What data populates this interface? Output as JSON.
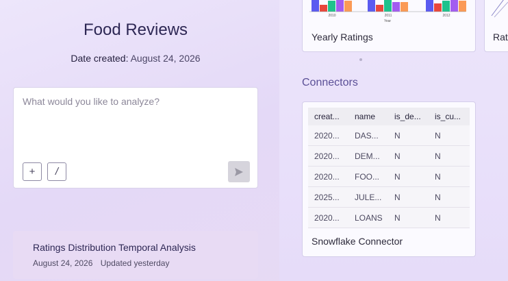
{
  "header": {
    "title": "Food Reviews",
    "date_label": "Date created:",
    "date_value": "August 24, 2026"
  },
  "composer": {
    "placeholder": "What would you like to analyze?",
    "add_label": "+",
    "slash_label": "/"
  },
  "analysis_item": {
    "title": "Ratings Distribution Temporal Analysis",
    "date": "August 24, 2026",
    "updated": "Updated yesterday"
  },
  "cards": {
    "yearly": {
      "title": "Yearly Ratings",
      "chart_data": {
        "type": "bar",
        "categories": [
          "2010",
          "2011",
          "2012"
        ],
        "xlabel": "Year",
        "series_colors": [
          "#5b5bf0",
          "#e8473c",
          "#1fc28c",
          "#a25cf0",
          "#fb9a56"
        ]
      }
    },
    "next_partial_title": "Rat"
  },
  "connectors": {
    "section_title": "Connectors",
    "table": {
      "columns": [
        "creat...",
        "name",
        "is_de...",
        "is_cu..."
      ],
      "rows": [
        [
          "2020...",
          "DAS...",
          "N",
          "N"
        ],
        [
          "2020...",
          "DEM...",
          "N",
          "N"
        ],
        [
          "2020...",
          "FOO...",
          "N",
          "N"
        ],
        [
          "2025...",
          "JULE...",
          "N",
          "N"
        ],
        [
          "2020...",
          "LOANS",
          "N",
          "N"
        ]
      ]
    },
    "card_title": "Snowflake Connector"
  }
}
